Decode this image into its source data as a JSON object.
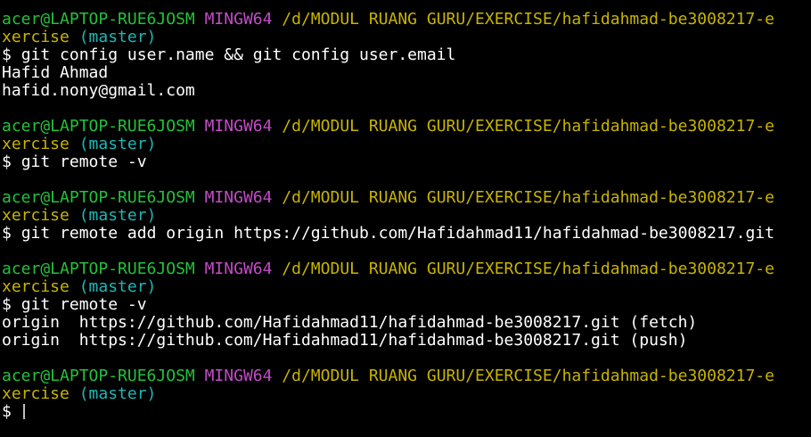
{
  "colors": {
    "background": "#000000",
    "user_host": "#22c23a",
    "system": "#c34bc8",
    "path": "#c8b400",
    "branch": "#1fb6b6",
    "text": "#ffffff"
  },
  "prompt": {
    "user_host": "acer@LAPTOP-RUE6JOSM",
    "system": "MINGW64",
    "path_line1": "/d/MODUL RUANG GURU/EXERCISE/hafidahmad-be3008217-e",
    "path_line2": "xercise",
    "branch": "(master)",
    "symbol": "$"
  },
  "blocks": [
    {
      "command": "git config user.name && git config user.email",
      "output": [
        "Hafid Ahmad",
        "hafid.nony@gmail.com"
      ]
    },
    {
      "command": "git remote -v",
      "output": []
    },
    {
      "command": "git remote add origin https://github.com/Hafidahmad11/hafidahmad-be3008217.git",
      "output": []
    },
    {
      "command": "git remote -v",
      "output": [
        "origin  https://github.com/Hafidahmad11/hafidahmad-be3008217.git (fetch)",
        "origin  https://github.com/Hafidahmad11/hafidahmad-be3008217.git (push)"
      ]
    },
    {
      "command": "",
      "output": []
    }
  ]
}
